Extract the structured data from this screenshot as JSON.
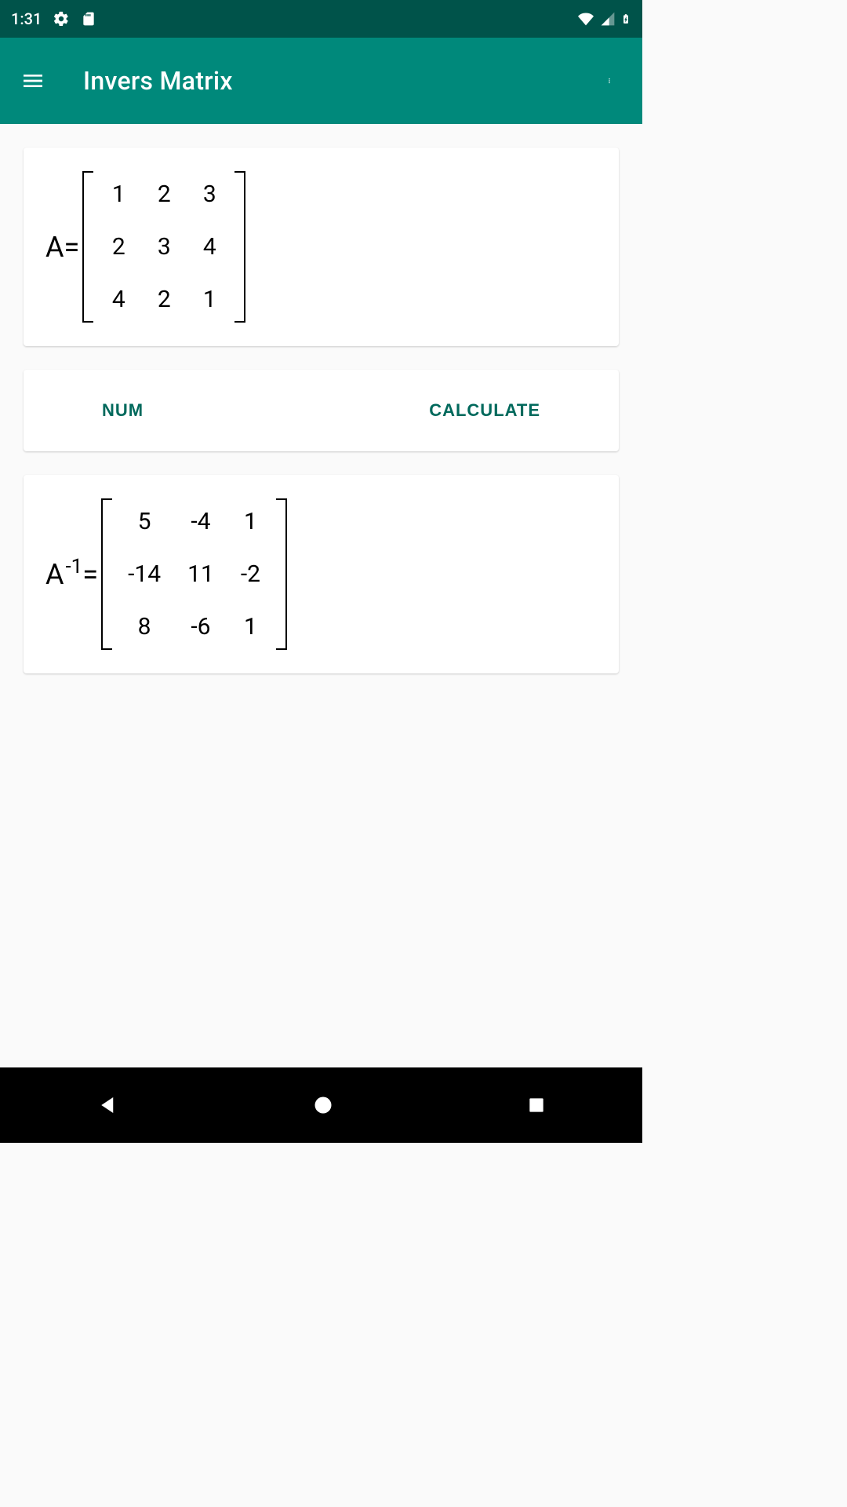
{
  "status": {
    "time": "1:31"
  },
  "appbar": {
    "title": "Invers Matrix"
  },
  "matrix_a": {
    "label_base": "A",
    "label_equals": "=",
    "rows": [
      [
        "1",
        "2",
        "3"
      ],
      [
        "2",
        "3",
        "4"
      ],
      [
        "4",
        "2",
        "1"
      ]
    ]
  },
  "actions": {
    "num": "NUM",
    "calculate": "CALCULATE"
  },
  "matrix_inv": {
    "label_base": "A",
    "label_sup": "-1",
    "label_equals": "=",
    "rows": [
      [
        "5",
        "-4",
        "1"
      ],
      [
        "-14",
        "11",
        "-2"
      ],
      [
        "8",
        "-6",
        "1"
      ]
    ]
  }
}
